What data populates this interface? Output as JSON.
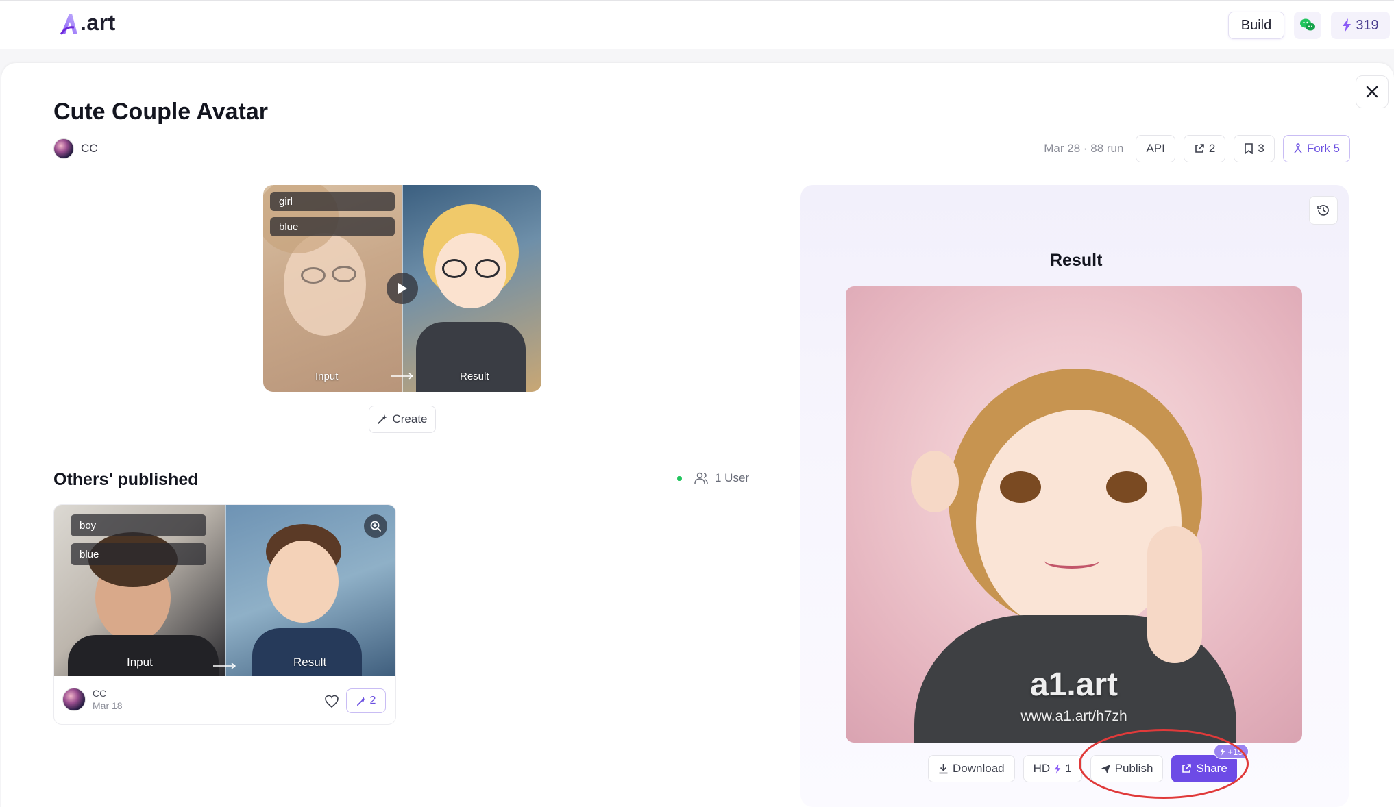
{
  "header": {
    "logo_text": ".art",
    "build_label": "Build",
    "credits": "319",
    "brand_color": "#6d4be6"
  },
  "page": {
    "title": "Cute Couple Avatar",
    "author": "CC",
    "meta": "Mar 28 · 88 run",
    "api_label": "API",
    "share_count": "2",
    "bookmark_count": "3",
    "fork_label": "Fork 5"
  },
  "preview": {
    "tags": [
      "girl",
      "blue"
    ],
    "input_label": "Input",
    "result_label": "Result",
    "create_label": "Create"
  },
  "others": {
    "title": "Others' published",
    "users": "1 User",
    "card": {
      "tags": [
        "boy",
        "blue"
      ],
      "input_label": "Input",
      "result_label": "Result",
      "author": "CC",
      "date": "Mar 18",
      "remix_count": "2"
    }
  },
  "result": {
    "title": "Result",
    "watermark": "a1.art",
    "watermark_url": "www.a1.art/h7zh",
    "download_label": "Download",
    "hd_label": "HD",
    "hd_cost": "1",
    "publish_label": "Publish",
    "share_label": "Share",
    "share_bonus": "+15"
  }
}
